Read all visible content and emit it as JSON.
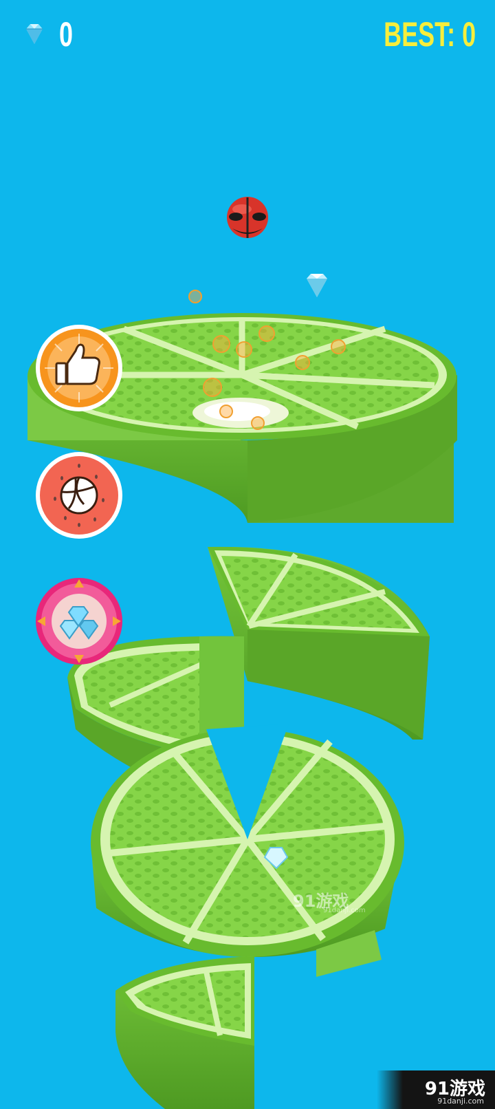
{
  "hud": {
    "gem_count": "0",
    "best_label": "BEST: 0",
    "gem_icon": "diamond-icon"
  },
  "side_buttons": [
    {
      "icon": "thumbs-up-icon",
      "color": "#f7941d"
    },
    {
      "icon": "volleyball-icon",
      "color": "#f26552"
    },
    {
      "icon": "diamonds-icon",
      "color": "#e8277a"
    }
  ],
  "colors": {
    "sky": "#0db7ec",
    "lime_rind": "#6cbf35",
    "lime_flesh": "#88d84a",
    "hud_best": "#f7ee3c"
  },
  "watermark": {
    "center_text": "91游戏",
    "center_sub": "91danji.com",
    "corner_text": "91游戏",
    "corner_sub": "91danji.com"
  }
}
